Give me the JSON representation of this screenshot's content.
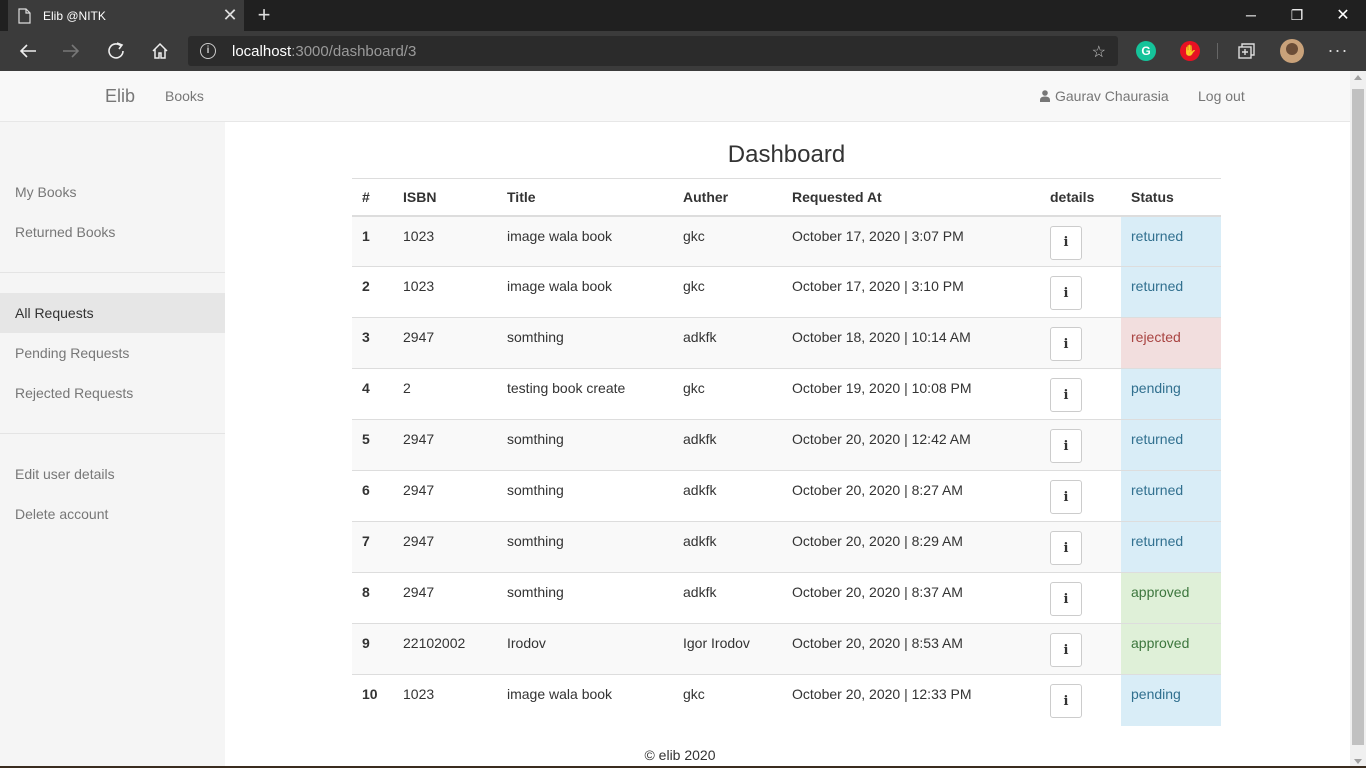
{
  "browser": {
    "tab_title": "Elib @NITK",
    "url_host": "localhost",
    "url_path": ":3000/dashboard/3"
  },
  "navbar": {
    "brand": "Elib",
    "books_link": "Books",
    "user_name": "Gaurav Chaurasia",
    "logout": "Log out"
  },
  "sidebar": {
    "items": [
      {
        "label": "My Books"
      },
      {
        "label": "Returned Books"
      },
      {
        "label": "All Requests",
        "active": true
      },
      {
        "label": "Pending Requests"
      },
      {
        "label": "Rejected Requests"
      },
      {
        "label": "Edit user details"
      },
      {
        "label": "Delete account"
      }
    ]
  },
  "main": {
    "title": "Dashboard",
    "columns": [
      "#",
      "ISBN",
      "Title",
      "Auther",
      "Requested At",
      "details",
      "Status"
    ],
    "rows": [
      {
        "num": "1",
        "isbn": "1023",
        "title": "image wala book",
        "author": "gkc",
        "requested_at": "October 17, 2020 | 3:07 PM",
        "details": "i",
        "status": "returned"
      },
      {
        "num": "2",
        "isbn": "1023",
        "title": "image wala book",
        "author": "gkc",
        "requested_at": "October 17, 2020 | 3:10 PM",
        "details": "i",
        "status": "returned"
      },
      {
        "num": "3",
        "isbn": "2947",
        "title": "somthing",
        "author": "adkfk",
        "requested_at": "October 18, 2020 | 10:14 AM",
        "details": "i",
        "status": "rejected"
      },
      {
        "num": "4",
        "isbn": "2",
        "title": "testing book create",
        "author": "gkc",
        "requested_at": "October 19, 2020 | 10:08 PM",
        "details": "i",
        "status": "pending"
      },
      {
        "num": "5",
        "isbn": "2947",
        "title": "somthing",
        "author": "adkfk",
        "requested_at": "October 20, 2020 | 12:42 AM",
        "details": "i",
        "status": "returned"
      },
      {
        "num": "6",
        "isbn": "2947",
        "title": "somthing",
        "author": "adkfk",
        "requested_at": "October 20, 2020 | 8:27 AM",
        "details": "i",
        "status": "returned"
      },
      {
        "num": "7",
        "isbn": "2947",
        "title": "somthing",
        "author": "adkfk",
        "requested_at": "October 20, 2020 | 8:29 AM",
        "details": "i",
        "status": "returned"
      },
      {
        "num": "8",
        "isbn": "2947",
        "title": "somthing",
        "author": "adkfk",
        "requested_at": "October 20, 2020 | 8:37 AM",
        "details": "i",
        "status": "approved"
      },
      {
        "num": "9",
        "isbn": "22102002",
        "title": "Irodov",
        "author": "Igor Irodov",
        "requested_at": "October 20, 2020 | 8:53 AM",
        "details": "i",
        "status": "approved"
      },
      {
        "num": "10",
        "isbn": "1023",
        "title": "image wala book",
        "author": "gkc",
        "requested_at": "October 20, 2020 | 12:33 PM",
        "details": "i",
        "status": "pending"
      }
    ]
  },
  "footer": {
    "text": "© elib 2020"
  },
  "status_colors": {
    "returned": "#d9edf7",
    "pending": "#d9edf7",
    "rejected": "#f2dede",
    "approved": "#dff0d8"
  },
  "icons": [
    "page-icon",
    "close-icon",
    "plus-icon",
    "minimize-icon",
    "maximize-icon",
    "back-arrow-icon",
    "forward-arrow-icon",
    "refresh-icon",
    "home-icon",
    "info-icon",
    "star-icon",
    "grammarly-icon",
    "adblock-icon",
    "collections-icon",
    "profile-avatar",
    "more-icon",
    "user-icon"
  ]
}
